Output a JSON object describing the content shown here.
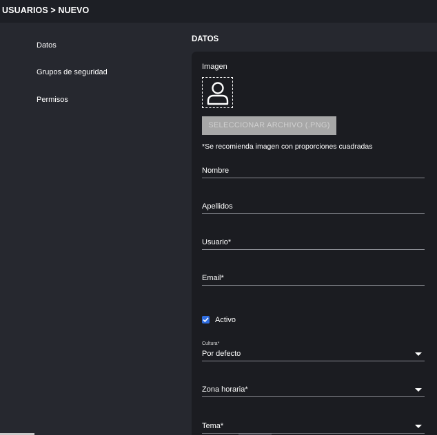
{
  "header": {
    "breadcrumb": "USUARIOS > NUEVO"
  },
  "sidebar": {
    "items": [
      {
        "label": "Datos"
      },
      {
        "label": "Grupos de seguridad"
      },
      {
        "label": "Permisos"
      }
    ]
  },
  "main": {
    "section_title": "DATOS",
    "image": {
      "label": "Imagen",
      "icon": "user-icon",
      "select_button": "SELECCIONAR ARCHIVO (.PNG)",
      "hint": "*Se recomienda imagen con proporciones cuadradas"
    },
    "fields": {
      "nombre": {
        "label": "Nombre",
        "value": ""
      },
      "apellidos": {
        "label": "Apellidos",
        "value": ""
      },
      "usuario": {
        "label": "Usuario*",
        "value": ""
      },
      "email": {
        "label": "Email*",
        "value": ""
      }
    },
    "activo": {
      "label": "Activo",
      "checked": true
    },
    "cultura": {
      "label": "Cultura*",
      "value": "Por defecto"
    },
    "zona_horaria": {
      "label": "Zona horaria*",
      "value": ""
    },
    "tema": {
      "label": "Tema*",
      "value": ""
    }
  },
  "colors": {
    "background": "#26282f",
    "topbar": "#1d1f25",
    "card": "#1b1c21",
    "accent": "#2f6de0",
    "button_disabled": "#a7a7a7"
  }
}
